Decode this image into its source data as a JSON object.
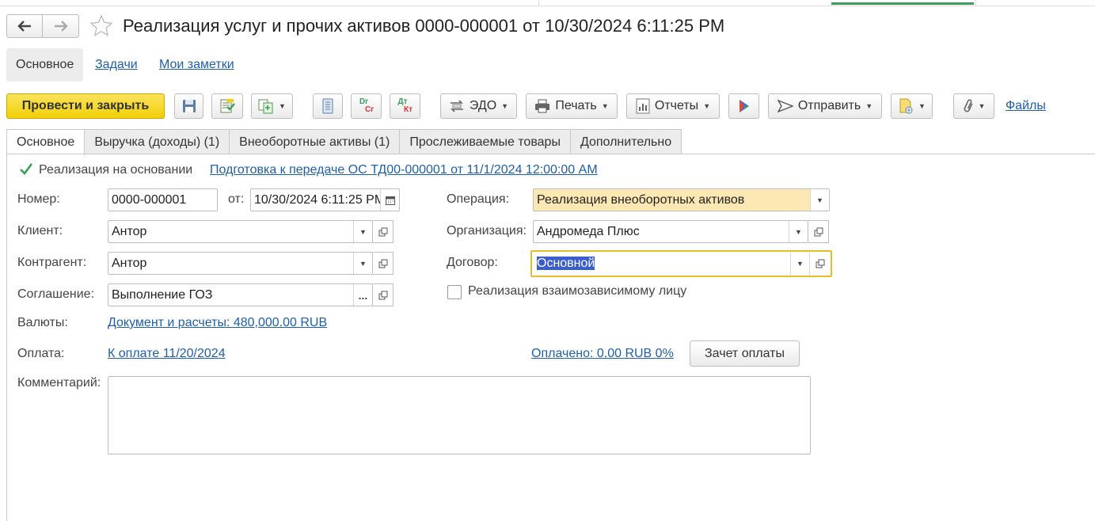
{
  "window": {
    "title": "Реализация услуг и прочих активов 0000-000001 от 10/30/2024 6:11:25 PM"
  },
  "nav": {
    "back_icon": "arrow-left-icon",
    "forward_icon": "arrow-right-icon",
    "favorite_icon": "star-icon"
  },
  "sections": {
    "main": "Основное",
    "tasks": "Задачи",
    "notes": "Мои заметки"
  },
  "toolbar": {
    "post_close": "Провести и закрыть",
    "edo": "ЭДО",
    "print": "Печать",
    "reports": "Отчеты",
    "send": "Отправить",
    "files": "Файлы",
    "dr_cr_top": "Dr",
    "dr_cr_bottom": "Cr",
    "dt_kt_top": "Дт",
    "dt_kt_bottom": "Кт"
  },
  "form_tabs": [
    "Основное",
    "Выручка (доходы) (1)",
    "Внеоборотные активы (1)",
    "Прослеживаемые товары",
    "Дополнительно"
  ],
  "basis": {
    "label": "Реализация на основании",
    "checked": true,
    "link": "Подготовка к передаче ОС ТД00-000001 от 11/1/2024 12:00:00 AM"
  },
  "fields": {
    "number_label": "Номер:",
    "number_value": "0000-000001",
    "date_label": "от:",
    "date_value": "10/30/2024  6:11:25 PM",
    "client_label": "Клиент:",
    "client_value": "Антор",
    "contractor_label": "Контрагент:",
    "contractor_value": "Антор",
    "agreement_label": "Соглашение:",
    "agreement_value": "Выполнение ГОЗ",
    "currency_label": "Валюты:",
    "currency_link": "Документ и расчеты: 480,000.00 RUB",
    "payment_label": "Оплата:",
    "payment_link": "К оплате 11/20/2024",
    "comment_label": "Комментарий:",
    "comment_value": "",
    "operation_label": "Операция:",
    "operation_value": "Реализация внеоборотных активов",
    "organization_label": "Организация:",
    "organization_value": "Андромеда Плюс",
    "contract_label": "Договор:",
    "contract_value": "Основной",
    "interdependent_label": "Реализация взаимозависимому лицу",
    "interdependent_checked": false,
    "paid_link": "Оплачено: 0.00 RUB 0%",
    "offset_button": "Зачет оплаты"
  },
  "colors": {
    "primary_button": "#f2cf08",
    "link": "#1f5fa8",
    "operation_highlight": "#fde7b3",
    "focus_border": "#e8bd2a",
    "selection": "#3a5fcd",
    "active_tab_indicator": "#3a9d59"
  }
}
